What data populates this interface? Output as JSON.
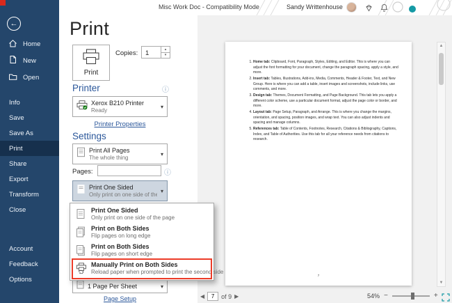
{
  "window": {
    "title": "Misc Work Doc - Compatibility Mode",
    "user_name": "Sandy Writtenhouse"
  },
  "icons": {
    "back": "←",
    "chevron_down": "▾",
    "info": "ⓘ",
    "spin_up": "▴",
    "spin_down": "▾",
    "scroll_up": "▲",
    "scroll_down": "▼",
    "prev": "◀",
    "next": "▶",
    "minus": "−",
    "plus": "+"
  },
  "sidebar": {
    "nav_items": [
      {
        "label": "Home"
      },
      {
        "label": "New"
      },
      {
        "label": "Open"
      }
    ],
    "menu_items": [
      "Info",
      "Save",
      "Save As",
      "Print",
      "Share",
      "Export",
      "Transform",
      "Close"
    ],
    "selected_item": "Print",
    "footer_items": [
      "Account",
      "Feedback",
      "Options"
    ]
  },
  "print_panel": {
    "title": "Print",
    "print_button_label": "Print",
    "copies_label": "Copies:",
    "copies_value": "1",
    "printer_section": {
      "heading": "Printer",
      "selected_printer": "Xerox B210 Printer",
      "printer_status": "Ready",
      "properties_link": "Printer Properties"
    },
    "settings_section": {
      "heading": "Settings",
      "range_dropdown": {
        "title": "Print All Pages",
        "subtitle": "The whole thing"
      },
      "pages_label": "Pages:",
      "pages_value": "",
      "sides_dropdown": {
        "title": "Print One Sided",
        "subtitle": "Only print on one side of the..."
      },
      "sides_menu": [
        {
          "title": "Print One Sided",
          "subtitle": "Only print on one side of the page"
        },
        {
          "title": "Print on Both Sides",
          "subtitle": "Flip pages on long edge"
        },
        {
          "title": "Print on Both Sides",
          "subtitle": "Flip pages on short edge"
        },
        {
          "title": "Manually Print on Both Sides",
          "subtitle": "Reload paper when prompted to print the second side"
        }
      ],
      "highlighted_menu_item": "Manually Print on Both Sides",
      "per_sheet_dropdown": {
        "title": "1 Page Per Sheet"
      },
      "page_setup_link": "Page Setup"
    }
  },
  "preview": {
    "page_items": [
      {
        "lead": "Home tab:",
        "text": "Clipboard, Font, Paragraph, Styles, Editing, and Editor. This is where you can adjust the font formatting for your document, change the paragraph spacing, apply a style, and more."
      },
      {
        "lead": "Insert tab:",
        "text": "Tables, Illustrations, Add-ins, Media, Comments, Header & Footer, Text, and New Group. Here is where you can add a table, insert images and screenshots, include links, use comments, and more."
      },
      {
        "lead": "Design tab:",
        "text": "Themes, Document Formatting, and Page Background. This tab lets you apply a different color scheme, use a particular document format, adjust the page color or border, and more."
      },
      {
        "lead": "Layout tab:",
        "text": "Page Setup, Paragraph, and Arrange. This is where you change the margins, orientation, and spacing, position images, and wrap text. You can also adjust indents and spacing and manage columns."
      },
      {
        "lead": "References tab:",
        "text": "Table of Contents, Footnotes, Research, Citations & Bibliography, Captions, Index, and Table of Authorities. Use this tab for all your reference needs from citations to research."
      }
    ],
    "page_number": "7",
    "nav": {
      "current_page": "7",
      "of_label": "of 9"
    },
    "zoom": {
      "value": "54%"
    }
  },
  "colors": {
    "accent_blue": "#2b579a",
    "sidebar_bg": "#24466b",
    "sidebar_selected": "#16304d",
    "annotation_red": "#ec3b28",
    "preview_bg": "#f1f1f1",
    "printer_ready_green": "#0e7a0e",
    "decoration_teal": "#159aa5"
  }
}
